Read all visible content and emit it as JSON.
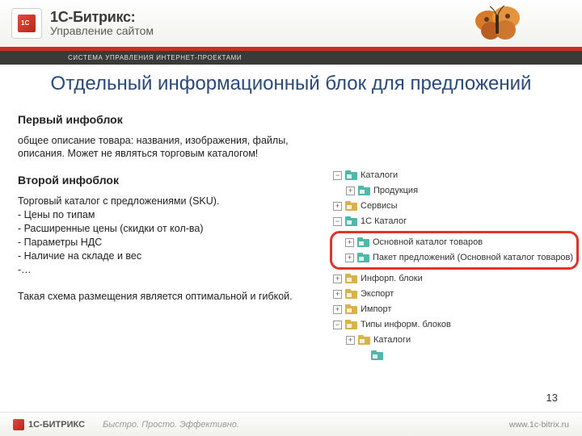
{
  "header": {
    "brand_top": "1С-Битрикс:",
    "brand_bottom": "Управление сайтом",
    "sub_bar": "СИСТЕМА УПРАВЛЕНИЯ ИНТЕРНЕТ-ПРОЕКТАМИ"
  },
  "slide": {
    "title": "Отдельный информационный блок для предложений",
    "h1": "Первый инфоблок",
    "p1": "общее описание товара: названия, изображения, файлы, описания. Может не являться торговым каталогом!",
    "h2": "Второй инфоблок",
    "p2": "Торговый каталог с предложениями (SKU).\n- Цены по типам\n- Расширенные цены (скидки от кол-ва)\n- Параметры НДС\n- Наличие на складе и вес\n-…",
    "p3": "Такая схема размещения является оптимальной и гибкой."
  },
  "tree": {
    "items": [
      {
        "level": 0,
        "exp": "-",
        "color": "teal",
        "label": "Каталоги"
      },
      {
        "level": 1,
        "exp": "+",
        "color": "teal",
        "label": "Продукция"
      },
      {
        "level": 0,
        "exp": "+",
        "color": "gold",
        "label": "Сервисы"
      },
      {
        "level": 0,
        "exp": "-",
        "color": "teal",
        "label": "1С Каталог"
      },
      {
        "level": 1,
        "exp": "+",
        "color": "teal",
        "label": "Основной каталог товаров",
        "hl": true
      },
      {
        "level": 1,
        "exp": "+",
        "color": "teal",
        "label": "Пакет предложений (Основной каталог товаров)",
        "hl": true
      },
      {
        "level": 0,
        "exp": "+",
        "color": "gold",
        "label": "Инфорп. блоки"
      },
      {
        "level": 0,
        "exp": "+",
        "color": "gold",
        "label": "Экспорт"
      },
      {
        "level": 0,
        "exp": "+",
        "color": "gold",
        "label": "Импорт"
      },
      {
        "level": 0,
        "exp": "-",
        "color": "gold",
        "label": "Типы информ. блоков"
      },
      {
        "level": 1,
        "exp": "+",
        "color": "gold",
        "label": "Каталоги"
      },
      {
        "level": 2,
        "exp": " ",
        "color": "teal",
        "label": ""
      }
    ]
  },
  "footer": {
    "brand": "1С-БИТРИКС",
    "tagline": "Быстро. Просто. Эффективно.",
    "url": "www.1c-bitrix.ru"
  },
  "page_number": "13"
}
